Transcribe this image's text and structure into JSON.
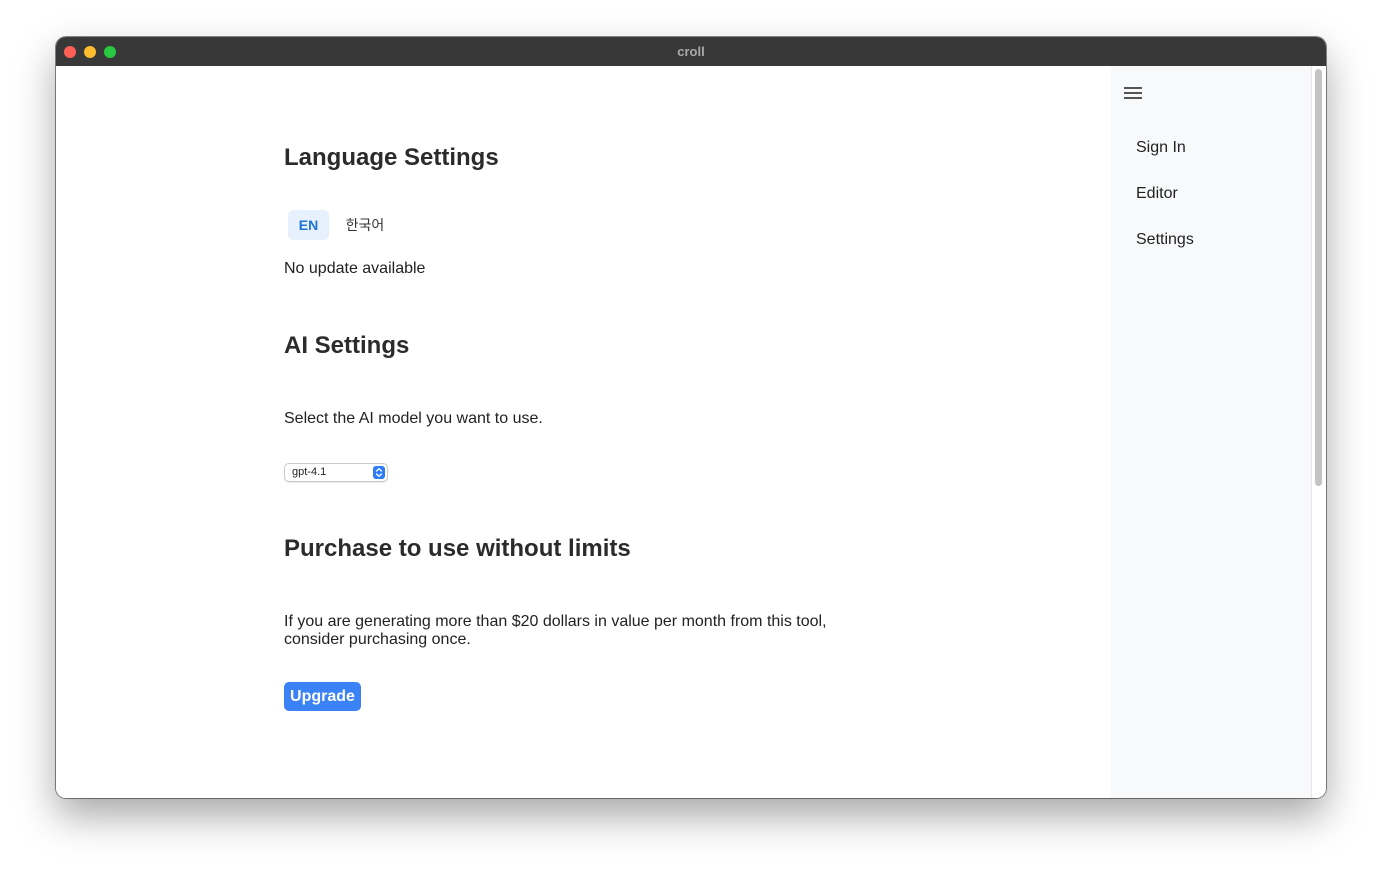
{
  "window": {
    "title": "croll"
  },
  "language_section": {
    "title": "Language Settings",
    "options": [
      "EN",
      "한국어"
    ],
    "selected": "EN",
    "update_status": "No update available"
  },
  "ai_section": {
    "title": "AI Settings",
    "description": "Select the AI model you want to use.",
    "model_selected": "gpt-4.1"
  },
  "purchase_section": {
    "title": "Purchase to use without limits",
    "description_line1": "If you are generating more than $20 dollars in value per month from this tool,",
    "description_line2": "consider purchasing once.",
    "button_label": "Upgrade"
  },
  "sidebar": {
    "items": [
      {
        "label": "Sign In"
      },
      {
        "label": "Editor"
      },
      {
        "label": "Settings"
      }
    ]
  },
  "colors": {
    "accent": "#3b82f6",
    "titlebar": "#383838",
    "sidebar_bg": "#f8f9fb"
  }
}
